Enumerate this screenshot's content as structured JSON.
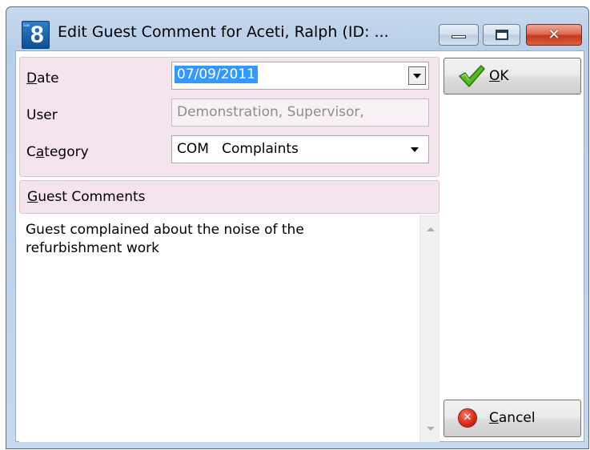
{
  "window": {
    "title": "Edit Guest Comment for Aceti, Ralph (ID: ...",
    "app_icon": {
      "number": "8",
      "mini_text": "Suite"
    },
    "controls": {
      "minimize": "minimize-icon",
      "maximize": "maximize-icon",
      "close": "close-icon"
    }
  },
  "form": {
    "date_label_u": "D",
    "date_label_rest": "ate",
    "date_value": "07/09/2011",
    "user_label": "User",
    "user_value": "Demonstration, Supervisor,",
    "category_label_pre": "C",
    "category_label_u": "a",
    "category_label_rest": "tegory",
    "category_value": "COM   Complaints"
  },
  "comments": {
    "header_u": "G",
    "header_rest": "uest Comments",
    "text": "Guest complained about the noise of the refurbishment work"
  },
  "buttons": {
    "ok_u": "O",
    "ok_rest": "K",
    "cancel_u": "C",
    "cancel_rest": "ancel"
  },
  "colors": {
    "title_bar": "#c6d9ee",
    "panel_bg": "#f4e4ee",
    "selection": "#3399ff",
    "close_button": "#c43a20"
  }
}
